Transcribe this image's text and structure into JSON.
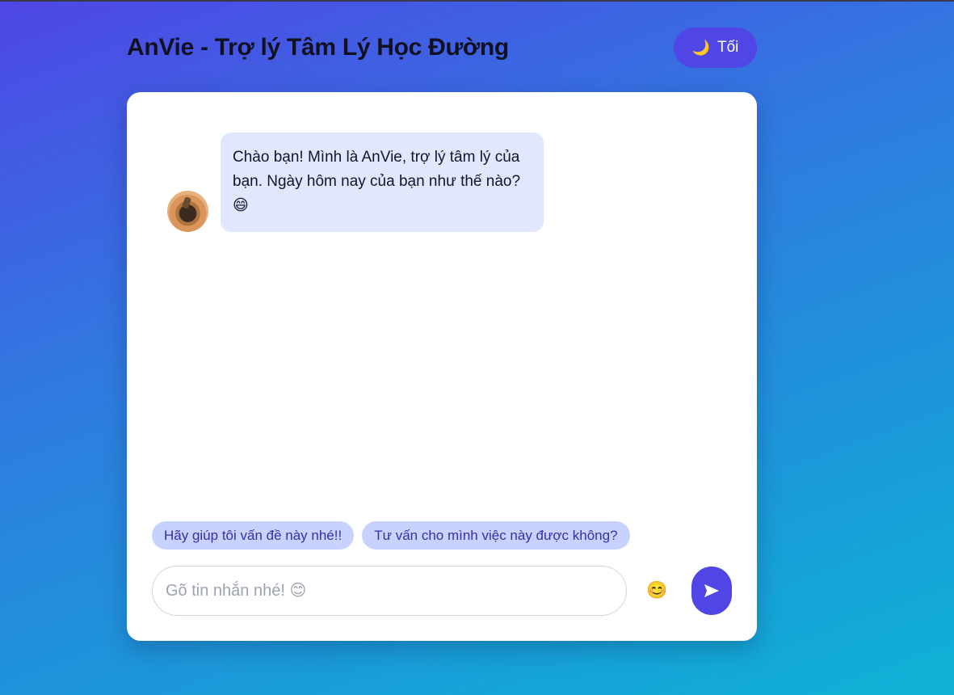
{
  "header": {
    "title": "AnVie - Trợ lý Tâm Lý Học Đường",
    "theme_toggle": {
      "icon": "🌙",
      "label": "Tối"
    }
  },
  "chat": {
    "messages": [
      {
        "sender": "bot",
        "text": "Chào bạn! Mình là AnVie, trợ lý tâm lý của bạn. Ngày hôm nay của bạn như thế nào? 😄"
      }
    ],
    "suggestions": [
      "Hãy giúp tôi vấn đề này nhé!!",
      "Tư vấn cho mình việc này được không?"
    ],
    "input": {
      "value": "",
      "placeholder": "Gõ tin nhắn nhé! 😊"
    },
    "emoji_button": "😊",
    "send_icon": "paper-plane-icon"
  },
  "colors": {
    "accent": "#4f46e5",
    "bubble_bg": "#e0e7ff",
    "chip_bg": "#c7d2fe",
    "chip_text": "#3730a3"
  }
}
